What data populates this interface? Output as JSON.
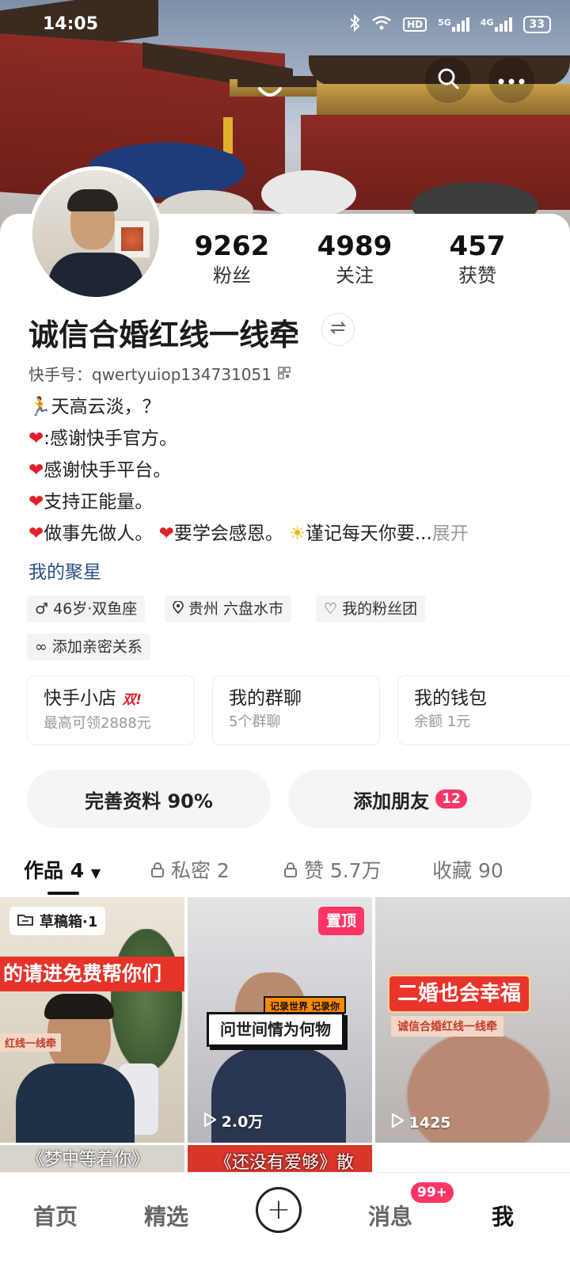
{
  "status_bar": {
    "time": "14:05",
    "network_labels": [
      "5G",
      "4G"
    ],
    "hd": "HD",
    "battery": "33"
  },
  "profile": {
    "stats": [
      {
        "value": "9262",
        "label": "粉丝"
      },
      {
        "value": "4989",
        "label": "关注"
      },
      {
        "value": "457",
        "label": "获赞"
      }
    ],
    "nickname": "诚信合婚红线一线牵",
    "uid": "快手号：qwertyuiop134731051",
    "bio": {
      "line1": "天高云淡，？",
      "line2": ":感谢快手官方。",
      "line3": "感谢快手平台。",
      "line4": "支持正能量。",
      "line5_a": "做事先做人。",
      "line5_b": "要学会感恩。",
      "line5_c": "谨记每天你要",
      "ellipsis": "...",
      "expand": "展开"
    },
    "star_link": "我的聚星",
    "tags": [
      "46岁·双鱼座",
      "贵州 六盘水市",
      "我的粉丝团",
      "添加亲密关系"
    ]
  },
  "cards": [
    {
      "title": "快手小店",
      "badge": "双!",
      "sub": "最高可领2888元"
    },
    {
      "title": "我的群聊",
      "sub": "5个群聊"
    },
    {
      "title": "我的钱包",
      "sub": "余额 1元"
    }
  ],
  "actions": {
    "complete_label": "完善资料 90%",
    "add_friend_label": "添加朋友",
    "add_friend_badge": "12"
  },
  "tabs": [
    {
      "label": "作品 4"
    },
    {
      "label": "私密 2"
    },
    {
      "label": "赞 5.7万"
    },
    {
      "label": "收藏 90"
    }
  ],
  "videos": [
    {
      "badge": "草稿箱·1",
      "banner": "的请进免费帮你们",
      "sublabel": "红线一线牵",
      "caption": "《梦中等着你》"
    },
    {
      "badge": "置顶",
      "tag": "记录世界 记录你",
      "title": "问世间情为何物",
      "views": "2.0万",
      "caption": "《还没有爱够》散"
    },
    {
      "banner": "二婚也会幸福",
      "sublabel": "诚信合婚红线一线牵",
      "views": "1425"
    }
  ],
  "bottom_nav": {
    "home": "首页",
    "featured": "精选",
    "messages": "消息",
    "messages_badge": "99+",
    "me": "我"
  },
  "colors": {
    "accent": "#fe3666",
    "link": "#2c4d86"
  }
}
